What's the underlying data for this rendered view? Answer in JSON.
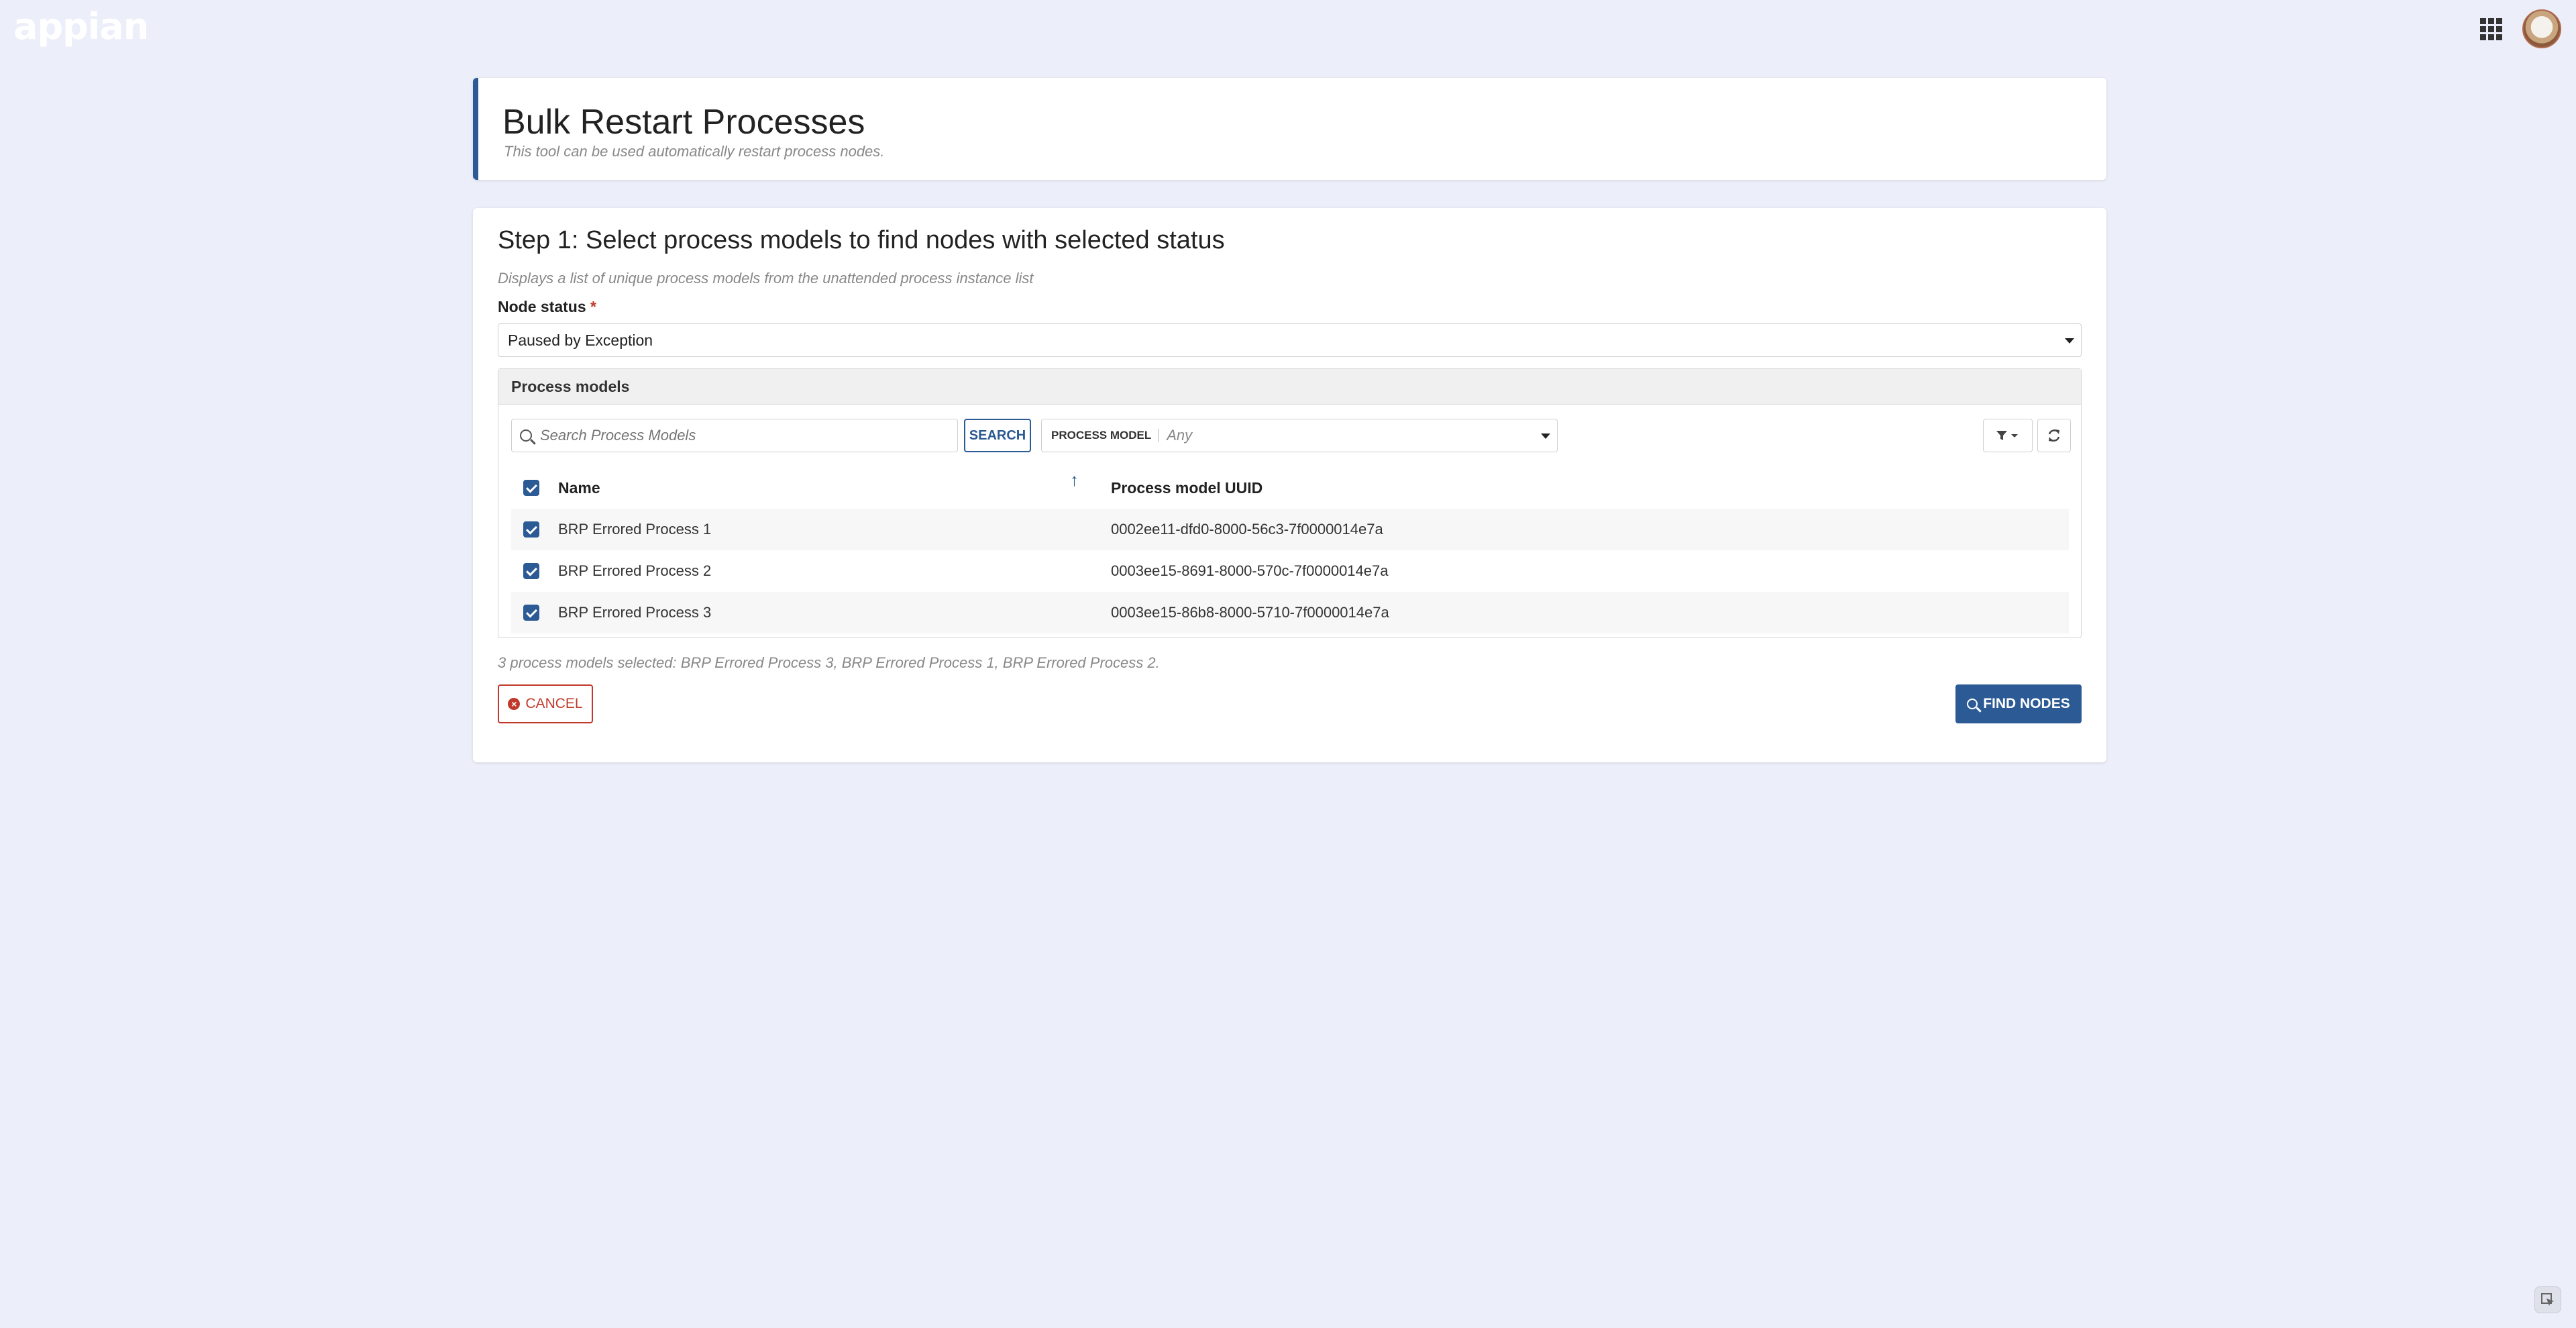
{
  "app": {
    "logo_text": "appian"
  },
  "header": {
    "title": "Bulk Restart Processes",
    "subtitle": "This tool can be used automatically restart process nodes."
  },
  "step": {
    "title": "Step 1: Select process models to find nodes with selected status",
    "description": "Displays a list of unique process models from the unattended process instance list",
    "node_status_label": "Node status",
    "required_marker": "*",
    "node_status_value": "Paused by Exception"
  },
  "panel": {
    "title": "Process models",
    "search_placeholder": "Search Process Models",
    "search_button": "SEARCH",
    "filter_label": "PROCESS MODEL",
    "filter_value": "Any",
    "columns": {
      "name": "Name",
      "uuid": "Process model UUID"
    },
    "rows": [
      {
        "name": "BRP Errored Process 1",
        "uuid": "0002ee11-dfd0-8000-56c3-7f0000014e7a"
      },
      {
        "name": "BRP Errored Process 2",
        "uuid": "0003ee15-8691-8000-570c-7f0000014e7a"
      },
      {
        "name": "BRP Errored Process 3",
        "uuid": "0003ee15-86b8-8000-5710-7f0000014e7a"
      }
    ]
  },
  "summary": "3 process models selected: BRP Errored Process 3, BRP Errored Process 1, BRP Errored Process 2.",
  "actions": {
    "cancel": "CANCEL",
    "find_nodes": "FIND NODES"
  },
  "colors": {
    "primary": "#2b5a94",
    "danger": "#c0392b",
    "background": "#eceef9"
  }
}
